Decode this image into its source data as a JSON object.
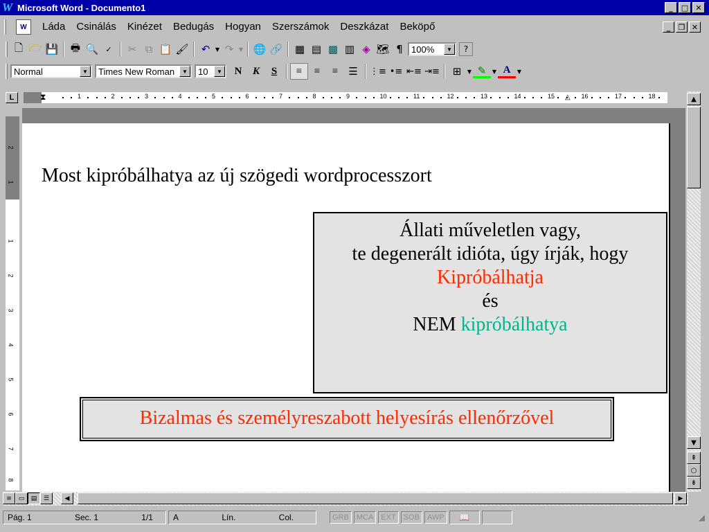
{
  "window": {
    "title": "Microsoft Word - Documento1",
    "app_icon": "W"
  },
  "menu": {
    "items": [
      "Láda",
      "Csinálás",
      "Kinézet",
      "Bedugás",
      "Hogyan",
      "Szerszámok",
      "Deszkázat",
      "Beköpő"
    ]
  },
  "toolbar": {
    "zoom": "100%"
  },
  "format": {
    "style": "Normal",
    "font": "Times New Roman",
    "size": "10",
    "bold": "N",
    "italic": "K",
    "underline": "S"
  },
  "ruler": {
    "numbers": [
      "1",
      "2",
      "3",
      "4",
      "5",
      "6",
      "7",
      "8",
      "9",
      "10",
      "11",
      "12",
      "13",
      "14",
      "15",
      "16",
      "17",
      "18"
    ]
  },
  "vruler": {
    "numbers": [
      "2",
      "1",
      "1",
      "2",
      "3",
      "4",
      "5",
      "6",
      "7",
      "8"
    ]
  },
  "document": {
    "line1": "Most kipróbálhatya az új szögedi wordprocesszort",
    "box1": {
      "line1": "Állati műveletlen vagy,",
      "line2": "te degenerált idióta, úgy írják, hogy",
      "line3": "Kipróbálhatja",
      "line4": "és",
      "line5a": "NEM",
      "line5b": "kipróbálhatya"
    },
    "box2": "Bizalmas és személyreszabott helyesírás ellenőrzővel"
  },
  "colors": {
    "titlebar": "#0000a8",
    "red_text": "#ff2a00",
    "teal_text": "#00b589"
  },
  "status": {
    "page": "Pág. 1",
    "sec": "Sec. 1",
    "pages": "1/1",
    "at": "A",
    "line": "Lín.",
    "col": "Col.",
    "flags": [
      "GRB",
      "MCA",
      "EXT",
      "SOB",
      "AWP"
    ]
  }
}
